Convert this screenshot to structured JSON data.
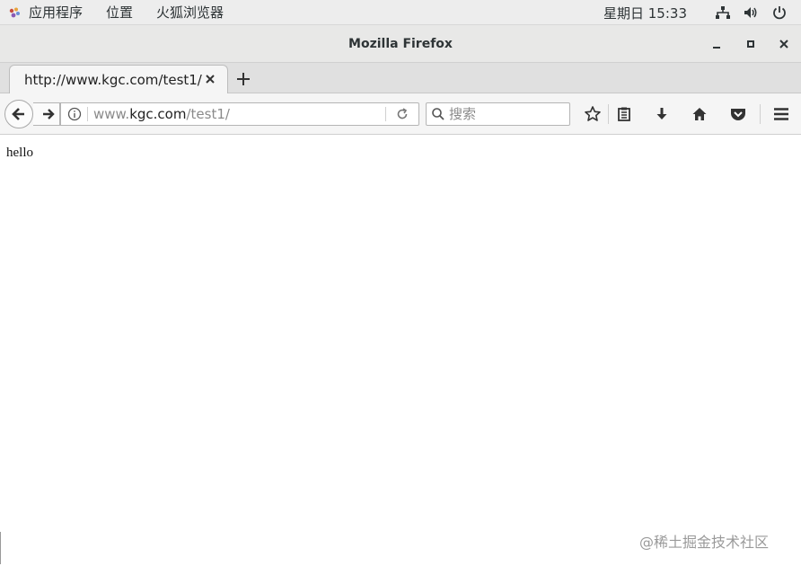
{
  "topbar": {
    "menus": [
      "应用程序",
      "位置",
      "火狐浏览器"
    ],
    "clock": "星期日 15:33"
  },
  "window": {
    "title": "Mozilla Firefox"
  },
  "tab": {
    "title": "http://www.kgc.com/test1/"
  },
  "urlbar": {
    "prefix": "www.",
    "domain": "kgc.com",
    "path": "/test1/"
  },
  "search": {
    "placeholder": "搜索"
  },
  "page": {
    "body_text": "hello"
  },
  "watermark": "@稀土掘金技术社区",
  "colors": {
    "topbar_bg": "#ededed",
    "titlebar_bg": "#e8e8e7",
    "toolbar_bg": "#f5f5f5"
  }
}
